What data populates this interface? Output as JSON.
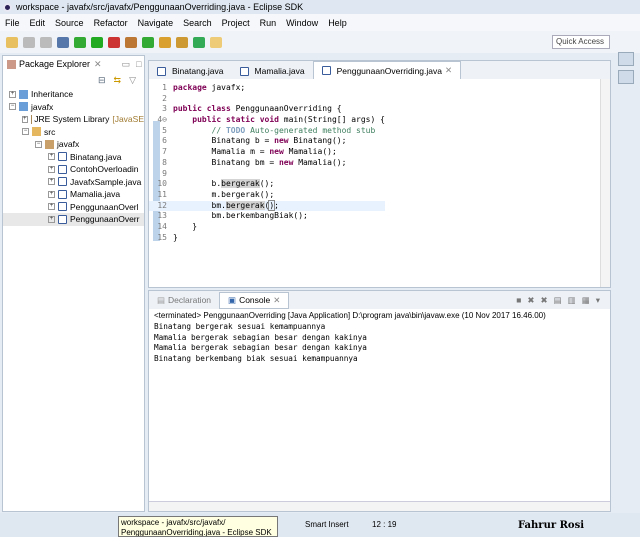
{
  "window": {
    "title": "workspace - javafx/src/javafx/PenggunaanOverriding.java - Eclipse SDK"
  },
  "menu": [
    "File",
    "Edit",
    "Source",
    "Refactor",
    "Navigate",
    "Search",
    "Project",
    "Run",
    "Window",
    "Help"
  ],
  "toolbar": {
    "quick_access": "Quick Access"
  },
  "package_explorer": {
    "title": "Package Explorer",
    "items": [
      {
        "label": "Inheritance",
        "level": 0,
        "icon": "project-icon"
      },
      {
        "label": "javafx",
        "level": 0,
        "icon": "project-icon"
      },
      {
        "label": "JRE System Library",
        "suffix": "[JavaSE",
        "level": 1,
        "icon": "library-icon"
      },
      {
        "label": "src",
        "level": 1,
        "icon": "folder-icon"
      },
      {
        "label": "javafx",
        "level": 2,
        "icon": "package-icon"
      },
      {
        "label": "Binatang.java",
        "level": 3,
        "icon": "java-file-icon"
      },
      {
        "label": "ContohOverloadin",
        "level": 3,
        "icon": "java-file-icon"
      },
      {
        "label": "JavafxSample.java",
        "level": 3,
        "icon": "java-file-icon"
      },
      {
        "label": "Mamalia.java",
        "level": 3,
        "icon": "java-file-icon"
      },
      {
        "label": "PenggunaanOverl",
        "level": 3,
        "icon": "java-file-icon"
      },
      {
        "label": "PenggunaanOverr",
        "level": 3,
        "icon": "java-file-icon"
      }
    ]
  },
  "editor": {
    "tabs": [
      "Binatang.java",
      "Mamalia.java",
      "PenggunaanOverriding.java"
    ],
    "active_tab": 2,
    "lines": [
      {
        "n": "1",
        "html": "<span class='kw'>package</span> javafx;"
      },
      {
        "n": "2",
        "html": ""
      },
      {
        "n": "3",
        "html": "<span class='kw'>public class</span> PenggunaanOverriding {"
      },
      {
        "n": "4⊖",
        "html": "    <span class='kw'>public static void</span> main(String[] args) {"
      },
      {
        "n": "5",
        "html": "        <span class='cm'>// <span class='cmb'>TODO</span> Auto-generated method stub</span>"
      },
      {
        "n": "6",
        "html": "        Binatang b = <span class='kw'>new</span> Binatang();"
      },
      {
        "n": "7",
        "html": "        Mamalia m = <span class='kw'>new</span> Mamalia();"
      },
      {
        "n": "8",
        "html": "        Binatang bm = <span class='kw'>new</span> Mamalia();"
      },
      {
        "n": "9",
        "html": ""
      },
      {
        "n": "10",
        "html": "        b.<span class='hl'>bergerak</span>();"
      },
      {
        "n": "11",
        "html": "        m.bergerak();"
      },
      {
        "n": "12",
        "html": "        bm.<span class='hl'>bergerak</span>(<span style='outline:1px solid #888'>)</span>;"
      },
      {
        "n": "13",
        "html": "        bm.berkembangBiak();"
      },
      {
        "n": "14",
        "html": "    }"
      },
      {
        "n": "15",
        "html": "}"
      }
    ]
  },
  "console": {
    "tabs": [
      "Declaration",
      "Console"
    ],
    "header": "<terminated> PenggunaanOverriding [Java Application] D:\\program java\\bin\\javaw.exe (10 Nov 2017 16.46.00)",
    "output": [
      "Binatang bergerak sesuai kemampuannya",
      "Mamalia bergerak sebagian besar dengan kakinya",
      "Mamalia bergerak sebagian besar dengan kakinya",
      "Binatang berkembang biak sesuai kemampuannya"
    ]
  },
  "status": {
    "insert_mode": "Smart Insert",
    "position": "12 : 19",
    "tooltip": "workspace - javafx/src/javafx/ PenggunaanOverriding.java - Eclipse SDK",
    "watermark": "Fahrur Rosi"
  }
}
